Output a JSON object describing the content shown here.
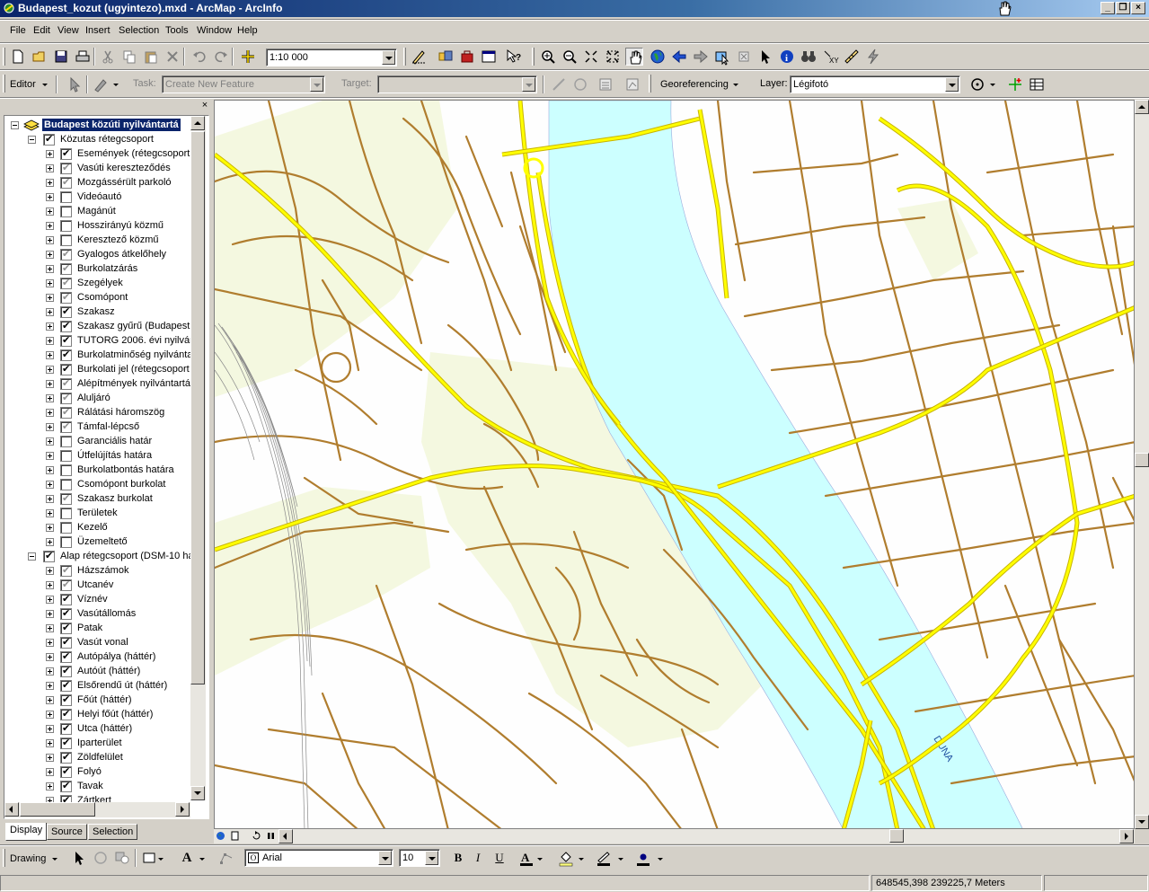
{
  "window": {
    "title": "Budapest_kozut (ugyintezo).mxd - ArcMap - ArcInfo",
    "minimize_label": "_",
    "restore_label": "❐",
    "close_label": "×"
  },
  "menu": [
    "File",
    "Edit",
    "View",
    "Insert",
    "Selection",
    "Tools",
    "Window",
    "Help"
  ],
  "standard_toolbar": {
    "scale_value": "1:10 000"
  },
  "editor_toolbar": {
    "editor_label": "Editor",
    "task_label": "Task:",
    "task_value": "Create New Feature",
    "target_label": "Target:",
    "target_value": "",
    "georef_label": "Georeferencing",
    "layer_label": "Layer:",
    "layer_value": "Légifotó"
  },
  "toc": {
    "root_label": "Budapest közúti nyilvántartá",
    "close_label": "×",
    "groups": [
      {
        "label": "Közutas rétegcsoport",
        "checked": "on",
        "layers": [
          {
            "label": "Események (rétegcsoport",
            "state": "on"
          },
          {
            "label": "Vasúti kereszteződés",
            "state": "grey"
          },
          {
            "label": "Mozgássérült parkoló",
            "state": "grey"
          },
          {
            "label": "Videóautó",
            "state": "off"
          },
          {
            "label": "Magánút",
            "state": "off"
          },
          {
            "label": "Hosszirányú közmű",
            "state": "off"
          },
          {
            "label": "Keresztező közmű",
            "state": "off"
          },
          {
            "label": "Gyalogos átkelőhely",
            "state": "grey"
          },
          {
            "label": "Burkolatzárás",
            "state": "grey"
          },
          {
            "label": "Szegélyek",
            "state": "grey"
          },
          {
            "label": "Csomópont",
            "state": "grey"
          },
          {
            "label": "Szakasz",
            "state": "on"
          },
          {
            "label": "Szakasz gyűrű (Budapest",
            "state": "on"
          },
          {
            "label": "TUTORG 2006. évi nyilvár",
            "state": "on"
          },
          {
            "label": "Burkolatminőség nyilvánta",
            "state": "on"
          },
          {
            "label": "Burkolati jel (rétegcsoport",
            "state": "on"
          },
          {
            "label": "Alépítmények nyilvántartá",
            "state": "grey"
          },
          {
            "label": "Aluljáró",
            "state": "grey"
          },
          {
            "label": "Rálátási háromszög",
            "state": "grey"
          },
          {
            "label": "Támfal-lépcső",
            "state": "grey"
          },
          {
            "label": "Garanciális határ",
            "state": "off"
          },
          {
            "label": "Útfelújítás határa",
            "state": "off"
          },
          {
            "label": "Burkolatbontás határa",
            "state": "off"
          },
          {
            "label": "Csomópont burkolat",
            "state": "off"
          },
          {
            "label": "Szakasz burkolat",
            "state": "grey"
          },
          {
            "label": "Területek",
            "state": "off"
          },
          {
            "label": "Kezelő",
            "state": "off"
          },
          {
            "label": "Üzemeltető",
            "state": "off"
          }
        ]
      },
      {
        "label": "Alap rétegcsoport (DSM-10 ha",
        "checked": "on",
        "layers": [
          {
            "label": "Házszámok",
            "state": "grey"
          },
          {
            "label": "Utcanév",
            "state": "grey"
          },
          {
            "label": "Víznév",
            "state": "on"
          },
          {
            "label": "Vasútállomás",
            "state": "on"
          },
          {
            "label": "Patak",
            "state": "on"
          },
          {
            "label": "Vasút vonal",
            "state": "on"
          },
          {
            "label": "Autópálya (háttér)",
            "state": "on"
          },
          {
            "label": "Autóút (háttér)",
            "state": "on"
          },
          {
            "label": "Elsőrendű út (háttér)",
            "state": "on"
          },
          {
            "label": "Főút (háttér)",
            "state": "on"
          },
          {
            "label": "Helyi főút (háttér)",
            "state": "on"
          },
          {
            "label": "Utca (háttér)",
            "state": "on"
          },
          {
            "label": "Iparterület",
            "state": "on"
          },
          {
            "label": "Zöldfelület",
            "state": "on"
          },
          {
            "label": "Folyó",
            "state": "on"
          },
          {
            "label": "Tavak",
            "state": "on"
          },
          {
            "label": "Zártkert",
            "state": "on"
          }
        ]
      }
    ],
    "tabs": [
      "Display",
      "Source",
      "Selection"
    ],
    "active_tab": "Display"
  },
  "map": {
    "river_label": "DUNA",
    "colors": {
      "water": "#ccffff",
      "green": "#f4f8e0",
      "street": "#b07d2e",
      "highway_fill": "#ffff00",
      "highway_edge": "#c8b400"
    }
  },
  "drawing_toolbar": {
    "drawing_label": "Drawing",
    "font_value": "Arial",
    "size_value": "10",
    "bold_label": "B",
    "italic_label": "I",
    "underline_label": "U",
    "text_tool_label": "A"
  },
  "status": {
    "coordinates": "648545,398  239225,7 Meters"
  }
}
